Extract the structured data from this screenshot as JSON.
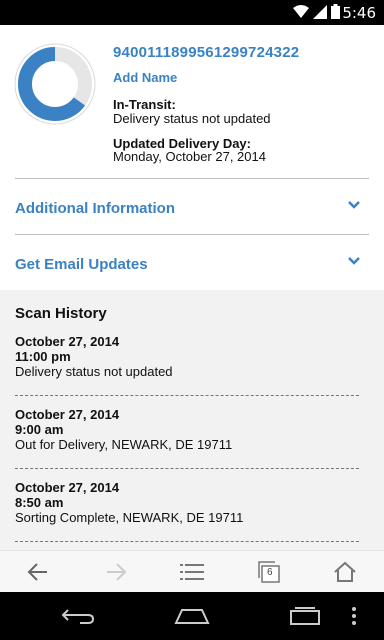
{
  "status_bar": {
    "time": "5:46"
  },
  "summary": {
    "tracking_number": "9400111899561299724322",
    "add_name_label": "Add Name",
    "status_label": "In-Transit:",
    "status_value": "Delivery status not updated",
    "delivery_label": "Updated Delivery Day:",
    "delivery_value": "Monday, October 27, 2014",
    "progress_fraction": 0.65,
    "colors": {
      "accent": "#3a82c4",
      "track": "#e6e6e6"
    }
  },
  "sections": [
    {
      "label": "Additional Information",
      "icon": "chevron-down-icon"
    },
    {
      "label": "Get Email Updates",
      "icon": "chevron-down-icon"
    }
  ],
  "scan_history": {
    "title": "Scan History",
    "entries": [
      {
        "date": "October 27, 2014",
        "time": "11:00 pm",
        "description": "Delivery status not updated"
      },
      {
        "date": "October 27, 2014",
        "time": "9:00 am",
        "description": "Out for Delivery, NEWARK, DE 19711"
      },
      {
        "date": "October 27, 2014",
        "time": "8:50 am",
        "description": "Sorting Complete, NEWARK, DE 19711"
      }
    ]
  },
  "toolbar": {
    "items": [
      "back-icon",
      "forward-icon",
      "menu-icon",
      "tabs-icon",
      "home-icon"
    ],
    "tab_count": "6"
  },
  "nav_bar": {
    "items": [
      "back-icon",
      "home-icon",
      "recent-apps-icon",
      "overflow-menu-icon"
    ]
  }
}
